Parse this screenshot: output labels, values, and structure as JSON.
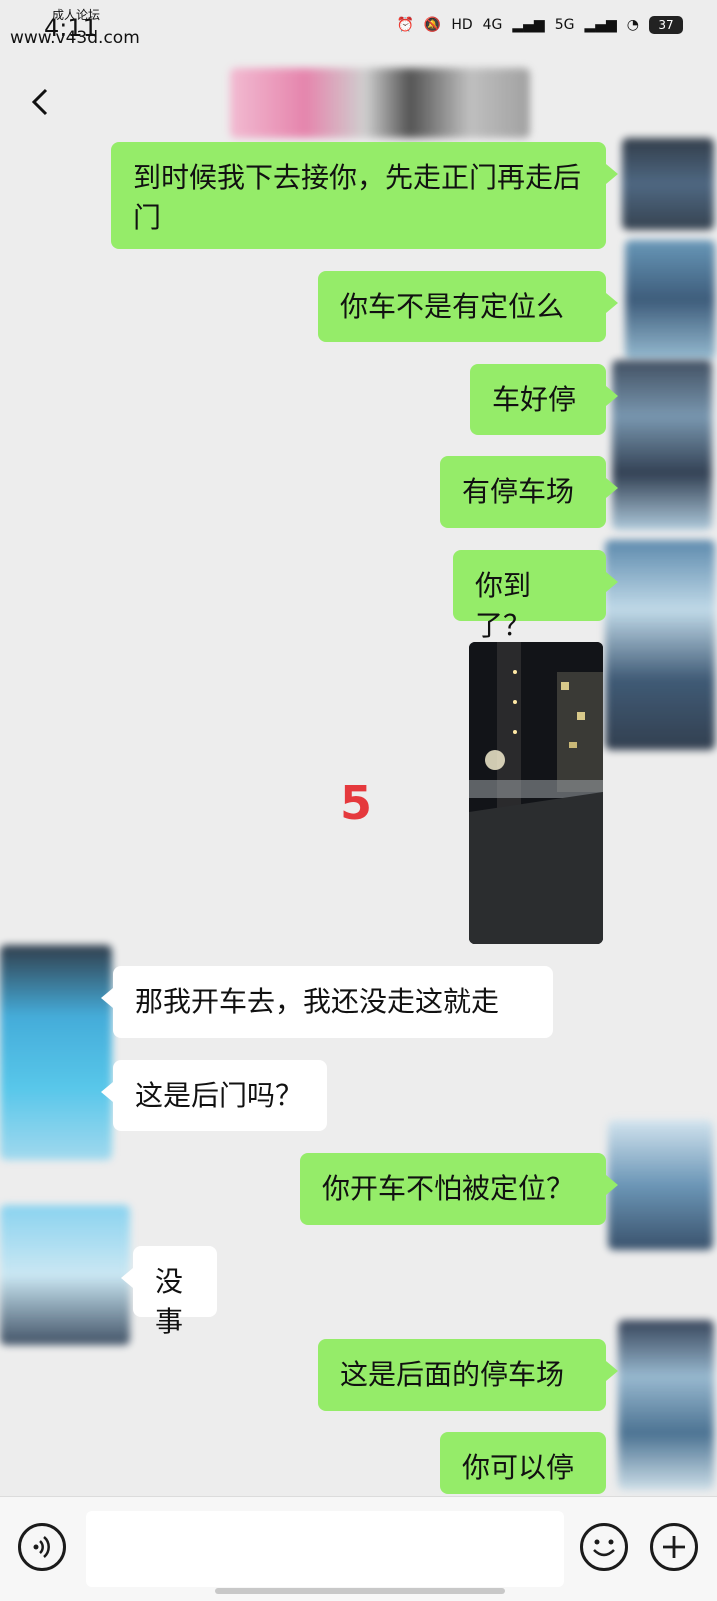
{
  "status_bar": {
    "time": "4:11",
    "watermark_top": "成人论坛",
    "watermark_url": "www.v43d.com",
    "network_1": "4G",
    "network_2": "5G",
    "hd_label": "HD",
    "battery": "37"
  },
  "colors": {
    "sent_bubble": "#95ec69",
    "received_bubble": "#ffffff",
    "background": "#ededed",
    "annotation": "#e5393d"
  },
  "annotation_label": "5",
  "messages": [
    {
      "side": "sent",
      "text": "到时候我下去接你，先走正门再走后门"
    },
    {
      "side": "sent",
      "text": "你车不是有定位么"
    },
    {
      "side": "sent",
      "text": "车好停"
    },
    {
      "side": "sent",
      "text": "有停车场"
    },
    {
      "side": "sent",
      "text": "你到了？"
    },
    {
      "side": "sent",
      "type": "image",
      "description": "night photo"
    },
    {
      "side": "received",
      "text": "那我开车去，我还没走这就走"
    },
    {
      "side": "received",
      "text": "这是后门吗？"
    },
    {
      "side": "sent",
      "text": "你开车不怕被定位？"
    },
    {
      "side": "received",
      "text": "没事"
    },
    {
      "side": "sent",
      "text": "这是后面的停车场"
    },
    {
      "side": "sent",
      "text": "你可以停"
    }
  ],
  "icons": {
    "back": "chevron-left-icon",
    "voice": "voice-icon",
    "emoji": "emoji-icon",
    "plus": "plus-icon"
  },
  "input": {
    "value": ""
  }
}
